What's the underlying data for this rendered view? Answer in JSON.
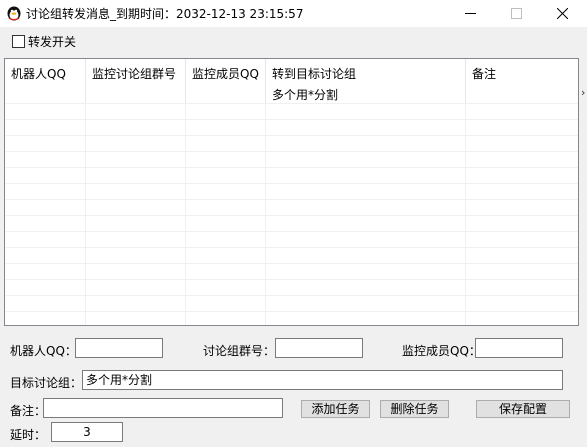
{
  "window": {
    "title": "讨论组转发消息_到期时间：2032-12-13 23:15:57"
  },
  "options": {
    "forward_switch_label": "转发开关",
    "forward_switch_checked": false
  },
  "table": {
    "columns": [
      "机器人QQ",
      "监控讨论组群号",
      "监控成员QQ",
      "转到目标讨论组\n多个用*分割",
      "备注"
    ],
    "rows": []
  },
  "form": {
    "robot_qq_label": "机器人QQ：",
    "robot_qq_value": "",
    "group_id_label": "讨论组群号：",
    "group_id_value": "",
    "monitor_member_label": "监控成员QQ：",
    "monitor_member_value": "",
    "target_group_label": "目标讨论组：",
    "target_group_value": "多个用*分割",
    "remark_label": "备注：",
    "remark_value": "",
    "delay_label": "延时：",
    "delay_value": "3"
  },
  "buttons": {
    "add_task": "添加任务",
    "delete_task": "删除任务",
    "save_config": "保存配置"
  }
}
